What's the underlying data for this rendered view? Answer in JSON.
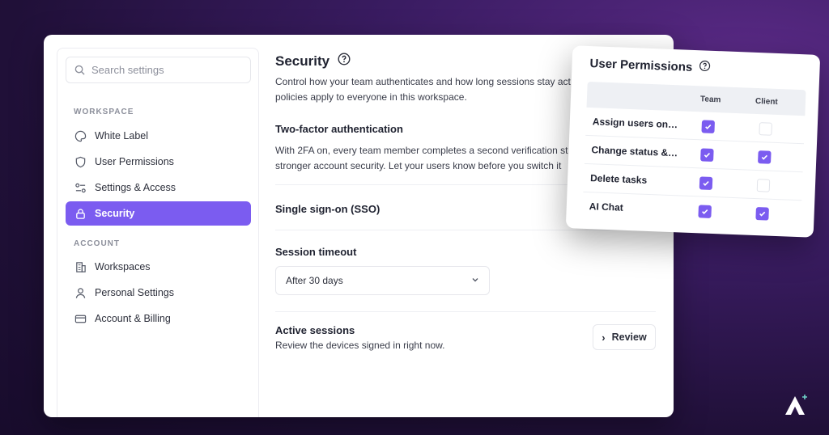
{
  "search": {
    "placeholder": "Search settings"
  },
  "sidebar": {
    "workspace_label": "WORKSPACE",
    "account_label": "ACCOUNT",
    "workspace_items": [
      {
        "label": "White Label",
        "icon": "palette-icon"
      },
      {
        "label": "User Permissions",
        "icon": "shield-icon"
      },
      {
        "label": "Settings & Access",
        "icon": "sliders-icon"
      },
      {
        "label": "Security",
        "icon": "lock-icon",
        "active": true
      }
    ],
    "account_items": [
      {
        "label": "Workspaces",
        "icon": "building-icon"
      },
      {
        "label": "Personal Settings",
        "icon": "user-icon"
      },
      {
        "label": "Account & Billing",
        "icon": "credit-card-icon"
      }
    ]
  },
  "main": {
    "title": "Security",
    "intro_line1": "Control how your team authenticates and how long sessions stay act",
    "intro_line2": "policies apply to everyone in this workspace.",
    "twofa_title": "Two-factor authentication",
    "twofa_line1": "With 2FA on, every team member completes a second verification st",
    "twofa_line2": "stronger account security. Let your users know before you switch it",
    "sso_title": "Single sign-on (SSO)",
    "session_title": "Session timeout",
    "session_value": "After 30 days",
    "active_title": "Active sessions",
    "active_desc": "Review the devices signed in right now.",
    "review_label": "Review"
  },
  "permissions": {
    "title": "User Permissions",
    "col_team": "Team",
    "col_client": "Client",
    "rows": [
      {
        "label": "Assign users on ta...",
        "team": true,
        "client": false
      },
      {
        "label": "Change status & pr...",
        "team": true,
        "client": true
      },
      {
        "label": "Delete tasks",
        "team": true,
        "client": false
      },
      {
        "label": "AI Chat",
        "team": true,
        "client": true
      }
    ]
  },
  "colors": {
    "accent": "#7b5cf0",
    "background": "#2a1548"
  }
}
